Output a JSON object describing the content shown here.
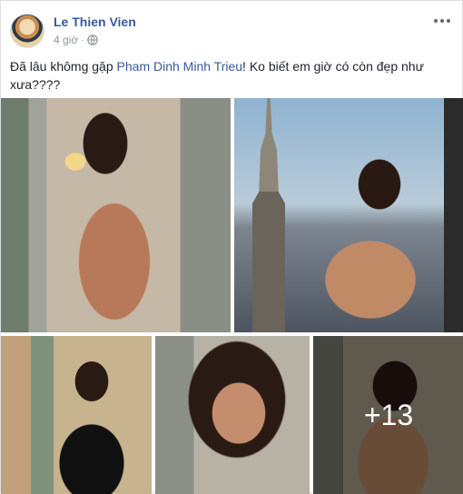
{
  "post": {
    "author": "Le Thien Vien",
    "time": "4 giờ",
    "separator": "·",
    "privacy_icon": "globe-icon",
    "menu_icon": "more-horizontal-icon",
    "text_before": "Đã lâu khômg gặp ",
    "mention": "Pham Dinh Minh Trieu",
    "text_after": "! Ko biết em giờ có còn đẹp như xưa????",
    "more_photos_label": "+13"
  },
  "colors": {
    "author": "#385898",
    "text": "#1d2129",
    "meta": "#90949c",
    "border": "#dddfe2"
  }
}
